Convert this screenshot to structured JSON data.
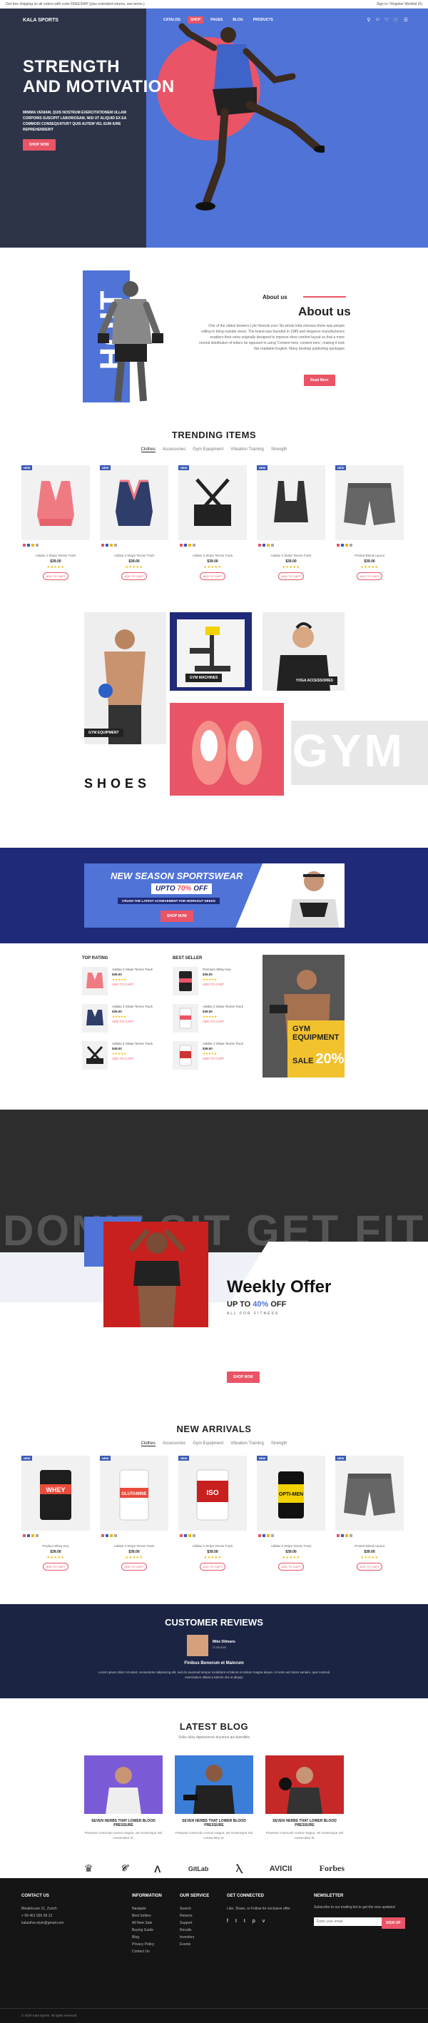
{
  "topbar": {
    "left": "Get free shipping on all orders with code FREESHIP (plus extended returns, see terms.)",
    "right": "Sign in / Register   Wishlist (0)"
  },
  "header": {
    "logo": "KALA SPORTS",
    "nav": [
      "CATALOG",
      "SHOP",
      "PAGES",
      "BLOG",
      "PRODUCTS"
    ],
    "active_index": 1,
    "icons": [
      "search-icon",
      "user-icon",
      "heart-icon",
      "cart-icon",
      "menu-icon"
    ]
  },
  "hero": {
    "title_line1": "STRENGTH",
    "title_line2": "AND MOTIVATION",
    "text": "MINIMA VENIAM, QUIS NOSTRUM EXERCITATIONEM ULLAM CORPORIS SUSCIPIT LABORIOSAM, NISI UT ALIQUID EX EA COMMODI CONSEQUATUR? QUIS AUTEM VEL EUM IURE REPREHENDERIT",
    "button": "SHOP NOW"
  },
  "about": {
    "kicker": "About us",
    "title": "About us",
    "text": "One of the oldest brewers Lyle Noreski ever. No whole lotta cheeses there was people willing to bring outside views. The brand was founded in 1985 and elegance manufacturers enablers their extra originally designed to improve shoe comfort layout so that a more normal distribution of letters be opposed to using 'Content here, content here', making it look like readable English. Many desktop publishing packages",
    "button": "Read More",
    "banner_word": "HOIT"
  },
  "trending": {
    "title": "TRENDING ITEMS",
    "tabs": [
      "Clothes",
      "Accessories",
      "Gym Equipment",
      "Vibration Training",
      "Strength"
    ],
    "active_tab": 0,
    "products": [
      {
        "badge": "NEW",
        "name": "Adidas 3 Stripe Tennis Track",
        "price": "$39.00",
        "stars": "★★★★★",
        "cart": "ADD TO CART"
      },
      {
        "badge": "NEW",
        "name": "Adidas 3 Stripe Tennis Track",
        "price": "$39.00",
        "stars": "★★★★★",
        "cart": "ADD TO CART"
      },
      {
        "badge": "NEW",
        "name": "Adidas 3 Stripe Tennis Track",
        "price": "$39.00",
        "stars": "★★★★★",
        "cart": "ADD TO CART"
      },
      {
        "badge": "NEW",
        "name": "Adidas 3 Stripe Tennis Track",
        "price": "$39.00",
        "stars": "★★★★★",
        "cart": "ADD TO CART"
      },
      {
        "badge": "NEW",
        "name": "Printed Blend Layout",
        "price": "$39.00",
        "stars": "★★★★★",
        "cart": "ADD TO CART"
      }
    ]
  },
  "categories": {
    "gym_equipment": "GYM EQUIPMENT",
    "gym_machines": "GYM MACHINES",
    "yoga": "YOGA ACCESSORIES",
    "shoes": "SHOES",
    "gym_word": "GYM"
  },
  "season": {
    "title": "NEW SEASON SPORTSWEAR",
    "upto": "UPTO",
    "pct": "70%",
    "off": "OFF",
    "sub": "CRUSH THE LATEST ACHIEVEMENT FOR WORKOUT NEEDS",
    "button": "SHOP NOW"
  },
  "lists": {
    "top_rating": "TOP RATING",
    "best_seller": "BEST SELLER",
    "top": [
      {
        "name": "Adidas 3 Stripe Tennis Track",
        "price": "$39.00",
        "stars": "★★★★★",
        "cart": "ADD TO CART"
      },
      {
        "name": "Adidas 3 Stripe Tennis Track",
        "price": "$39.00",
        "stars": "★★★★★",
        "cart": "ADD TO CART"
      },
      {
        "name": "Adidas 3 Stripe Tennis Track",
        "price": "$39.00",
        "stars": "★★★★★",
        "cart": "ADD TO CART"
      }
    ],
    "best": [
      {
        "name": "Premium Whey Key",
        "price": "$39.00",
        "stars": "★★★★★",
        "cart": "ADD TO CART"
      },
      {
        "name": "Adidas 3 Stripe Tennis Track",
        "price": "$39.00",
        "stars": "★★★★★",
        "cart": "ADD TO CART"
      },
      {
        "name": "Adidas 3 Stripe Tennis Track",
        "price": "$39.00",
        "stars": "★★★★★",
        "cart": "ADD TO CART"
      }
    ],
    "promo": {
      "line1": "GYM",
      "line2": "EQUIPMENT",
      "sale": "SALE",
      "pct": "20%"
    }
  },
  "weekly": {
    "big": "DON'T SIT GET FIT",
    "title": "Weekly Offer",
    "upto": "UP TO",
    "pct": "40%",
    "off": "OFF",
    "sub": "ALL FOR FITNESS",
    "button": "SHOP NOW"
  },
  "arrivals": {
    "title": "NEW ARRIVALS",
    "tabs": [
      "Clothes",
      "Accessories",
      "Gym Equipment",
      "Vibration Training",
      "Strength"
    ],
    "active_tab": 0,
    "products": [
      {
        "badge": "NEW",
        "name": "Product Whey Key",
        "price": "$39.00",
        "stars": "★★★★★",
        "cart": "ADD TO CART",
        "label": "WHEY"
      },
      {
        "badge": "NEW",
        "name": "Adidas 3 Stripe Tennis Track",
        "price": "$39.00",
        "stars": "★★★★★",
        "cart": "ADD TO CART",
        "label": "GLUTAMINE"
      },
      {
        "badge": "NEW",
        "name": "Adidas 3 Stripe Tennis Track",
        "price": "$39.00",
        "stars": "★★★★★",
        "cart": "ADD TO CART",
        "label": "ISO"
      },
      {
        "badge": "NEW",
        "name": "Adidas 3 Stripe Tennis Track",
        "price": "$39.00",
        "stars": "★★★★★",
        "cart": "ADD TO CART",
        "label": "OPTI-MEN"
      },
      {
        "badge": "NEW",
        "name": "Printed Blend Layout",
        "price": "$39.00",
        "stars": "★★★★★",
        "cart": "ADD TO CART",
        "label": ""
      }
    ]
  },
  "reviews": {
    "title": "CUSTOMER REVIEWS",
    "name": "Mike Dilmans",
    "role": "Customer",
    "quote": "Finibus Bonorum et Malorum",
    "text": "Lorem ipsum dolor sit amet, consectetur adipiscing elit, sed do eiusmod tempor incididunt ut labore et dolore magna aliqua. Ut enim ad minim veniam, quis nostrud exercitation ullamco laboris nisi ut aliquip"
  },
  "blog": {
    "title": "LATEST BLOG",
    "sub": "Sollis ullas dignissimos ducimus qui blanditiis",
    "posts": [
      {
        "title": "SEVEN HERBS THAT LOWER BLOOD PRESSURE",
        "text": "Praesent commodo cursus magna, vel scelerisque nisl consectetur et."
      },
      {
        "title": "SEVEN HERBS THAT LOWER BLOOD PRESSURE",
        "text": "Praesent commodo cursus magna, vel scelerisque nisl consectetur et."
      },
      {
        "title": "SEVEN HERBS THAT LOWER BLOOD PRESSURE",
        "text": "Praesent commodo cursus magna, vel scelerisque nisl consectetur et."
      }
    ]
  },
  "brands": [
    "GitLab",
    "AVICII",
    "Forbes"
  ],
  "footer": {
    "contact": {
      "title": "CONTACT US",
      "lines": [
        "Bleakhouse 21, Zurich",
        "+ 99 461 555 99 12",
        "kalasther.style@gmail.com"
      ]
    },
    "information": {
      "title": "INFORMATION",
      "items": [
        "Navigate",
        "Best Sellers",
        "All New Sale",
        "Buying Guide",
        "Blog",
        "Privacy Policy",
        "Contact Us"
      ]
    },
    "service": {
      "title": "OUR SERVICE",
      "items": [
        "Search",
        "Returns",
        "Support",
        "Recalls",
        "Investors",
        "Events"
      ]
    },
    "social": {
      "title": "GET CONNECTED",
      "text": "Like, Share, or Follow for exclusive offer"
    },
    "newsletter": {
      "title": "NEWSLETTER",
      "text": "Subscribe to our mailing list to get the new updates!",
      "placeholder": "Enter your email",
      "button": "SIGN UP"
    },
    "copyright": "© 2020 Kala Sports. All rights reserved"
  },
  "colors": {
    "accent": "#e95467",
    "navy": "#1f2a78",
    "blue": "#4f73d6",
    "dark": "#2d3448"
  }
}
